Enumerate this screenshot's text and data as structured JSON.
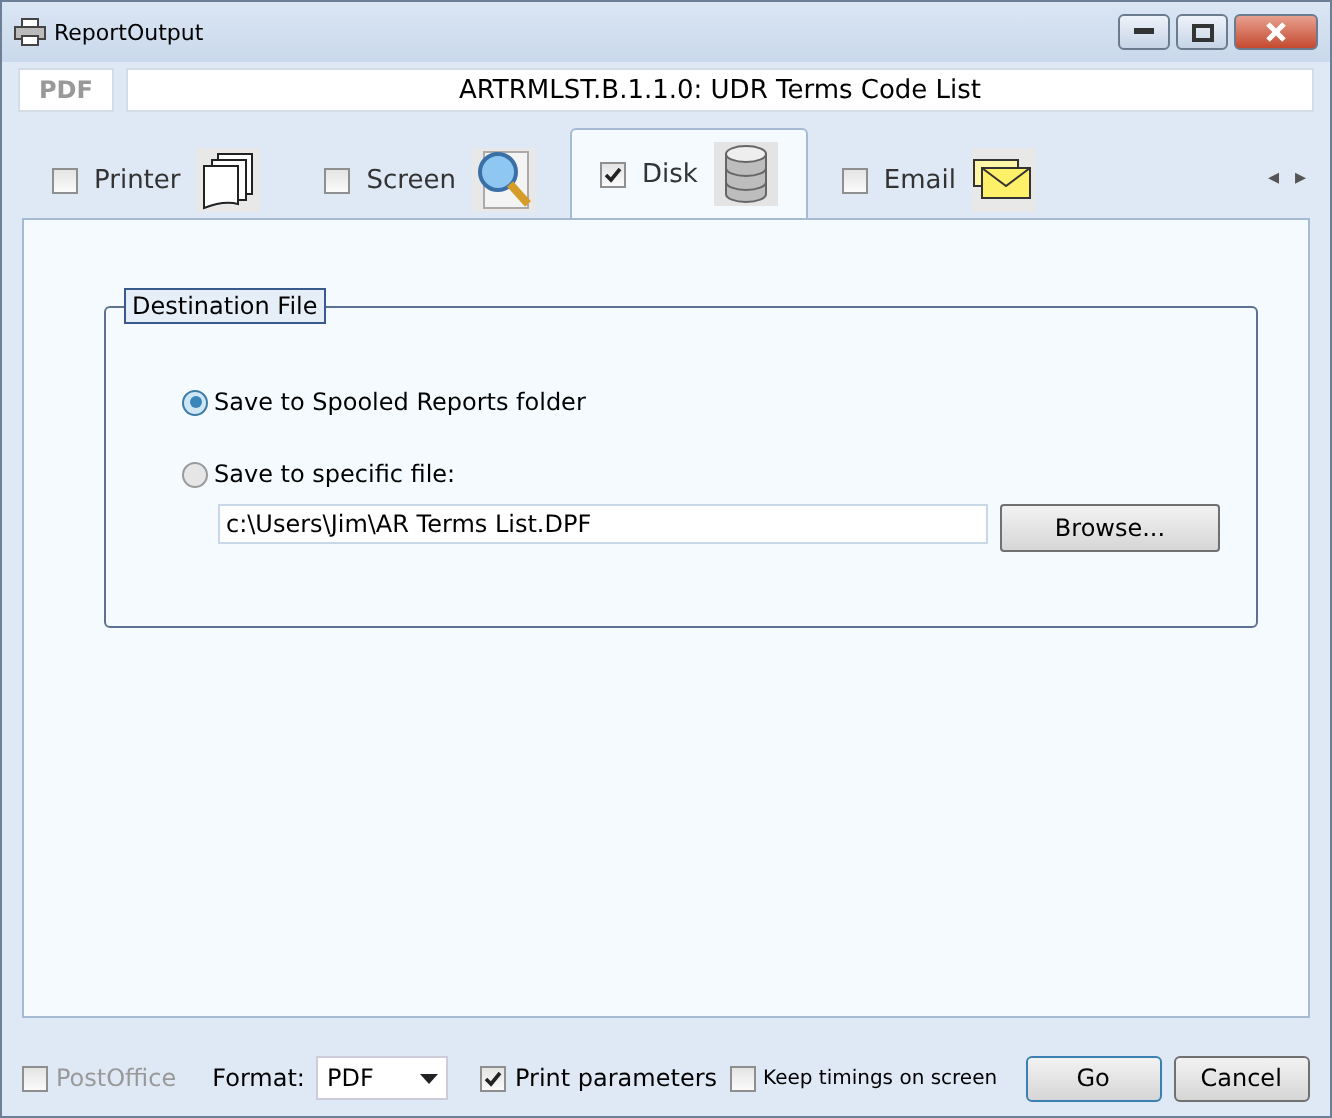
{
  "window": {
    "title": "ReportOutput"
  },
  "header": {
    "badge": "PDF",
    "report_title": "ARTRMLST.B.1.1.0: UDR Terms Code List"
  },
  "tabs": [
    {
      "label": "Printer",
      "kind": "printer",
      "checked": false,
      "selected": false
    },
    {
      "label": "Screen",
      "kind": "screen",
      "checked": false,
      "selected": false
    },
    {
      "label": "Disk",
      "kind": "disk",
      "checked": true,
      "selected": true
    },
    {
      "label": "Email",
      "kind": "email",
      "checked": false,
      "selected": false
    }
  ],
  "tab_scroll": {
    "left": "◂",
    "right": "▸"
  },
  "destination": {
    "legend": "Destination File",
    "options": [
      {
        "label": "Save to Spooled Reports folder",
        "selected": true
      },
      {
        "label": "Save to specific file:",
        "selected": false
      }
    ],
    "file_path": "c:\\Users\\Jim\\AR Terms List.DPF",
    "browse": "Browse..."
  },
  "footer": {
    "postoffice": {
      "label": "PostOffice",
      "checked": false,
      "disabled": true
    },
    "format_label": "Format:",
    "format": "PDF",
    "print_parameters": {
      "label": "Print parameters",
      "checked": true
    },
    "keep_timings": {
      "label": "Keep timings on screen",
      "checked": false
    },
    "buttons": [
      "Go",
      "Cancel"
    ]
  }
}
